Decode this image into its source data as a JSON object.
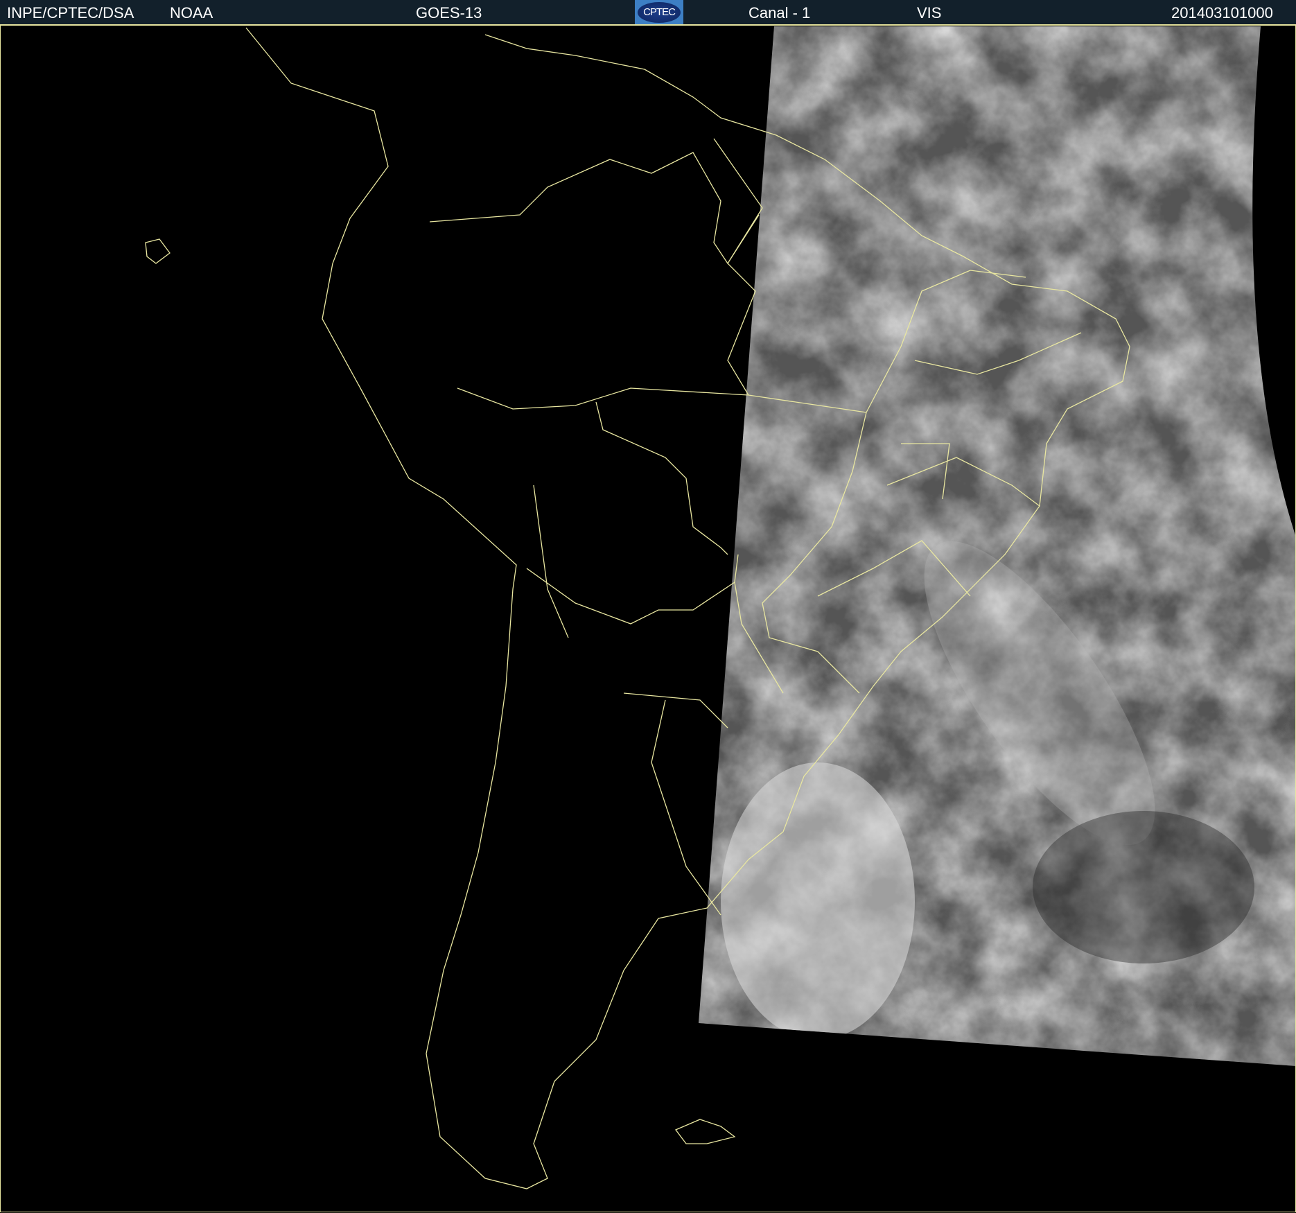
{
  "header": {
    "institution": "INPE/CPTEC/DSA",
    "agency": "NOAA",
    "satellite": "GOES-13",
    "logo_text": "CPTEC",
    "channel": "Canal - 1",
    "band": "VIS",
    "timestamp": "201403101000"
  },
  "colors": {
    "header_bg": "#12202b",
    "border_lines": "#e8e6a0",
    "logo_bg": "#3d7fc4"
  }
}
